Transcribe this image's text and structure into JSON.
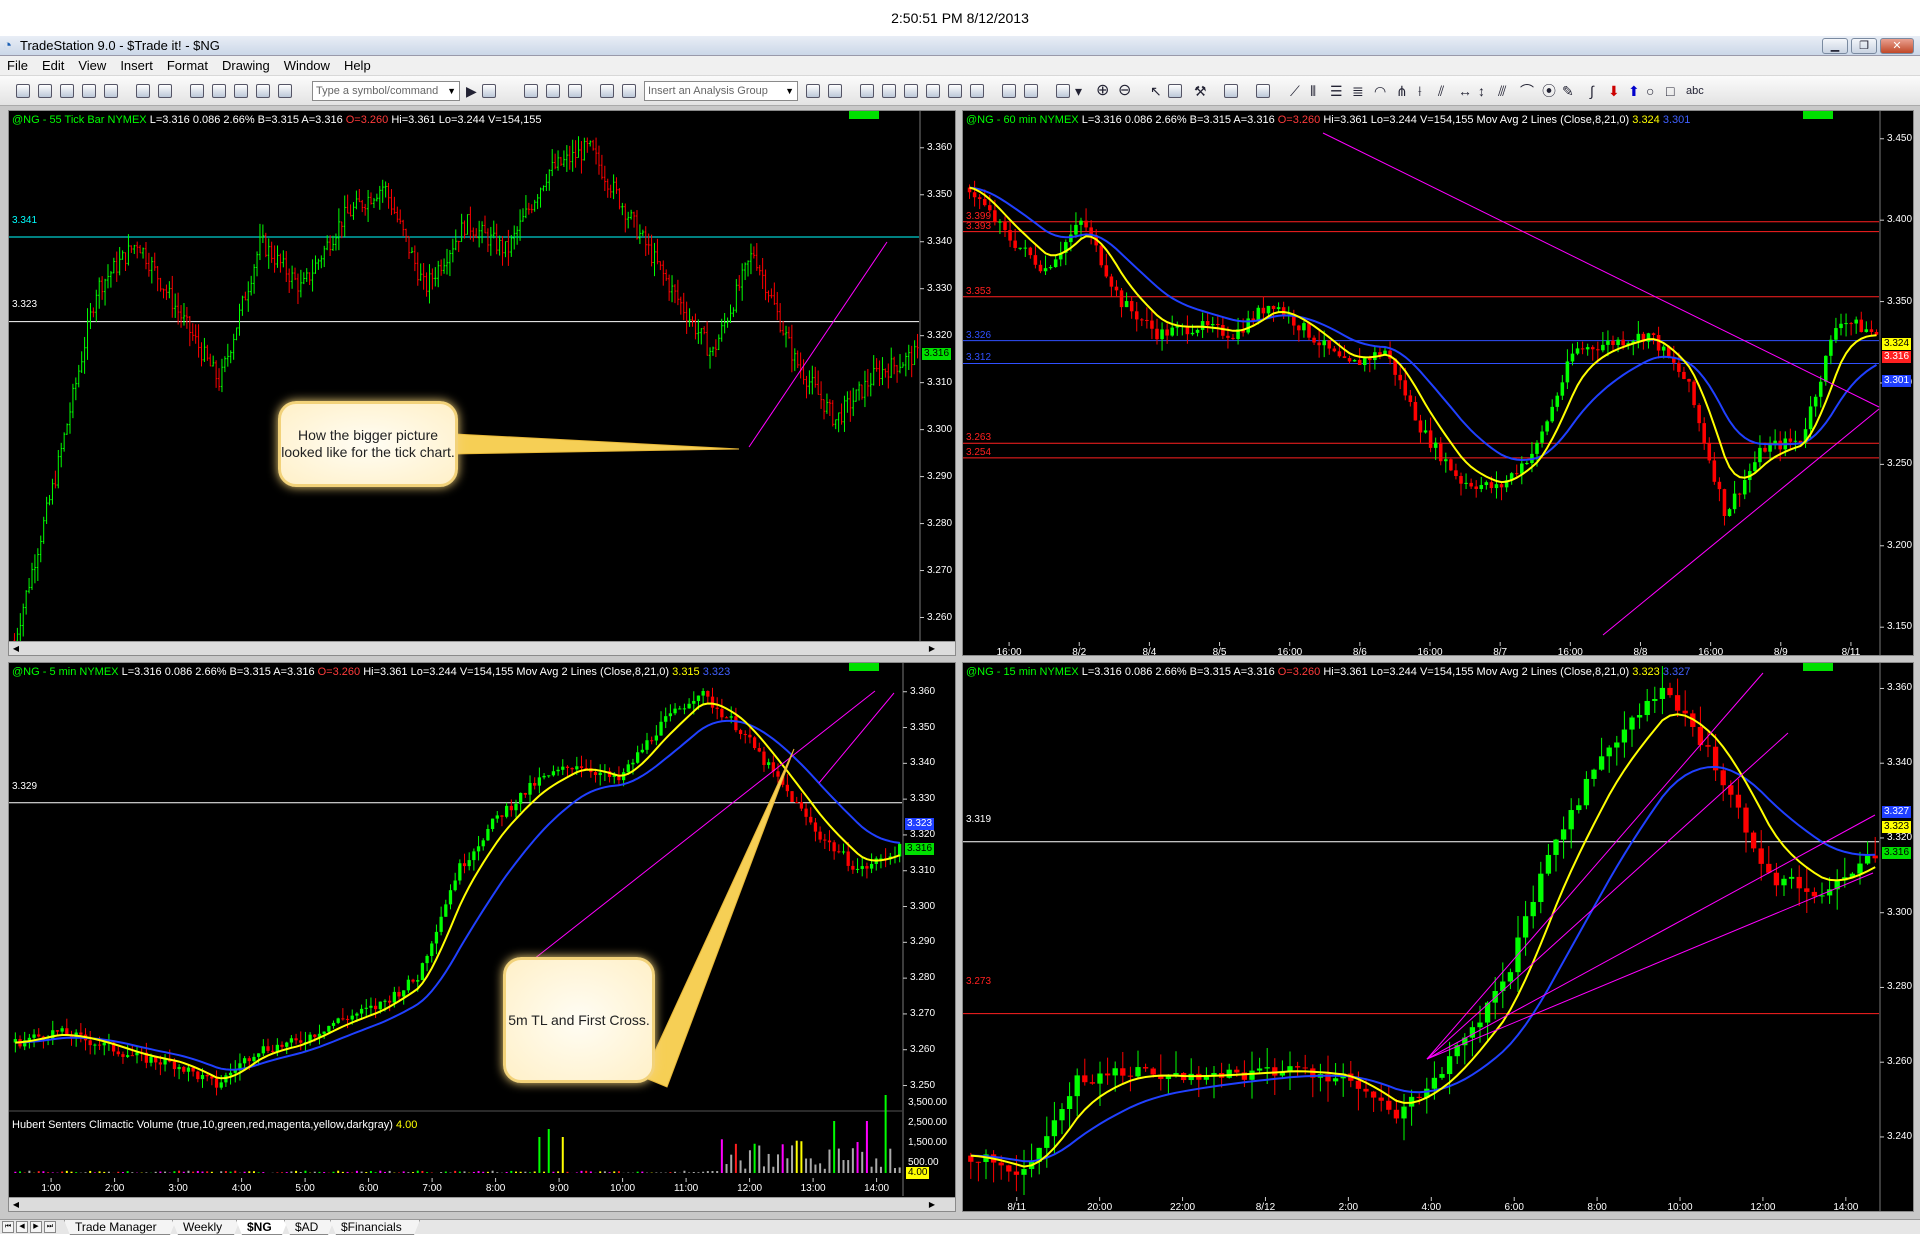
{
  "clock": "2:50:51 PM 8/12/2013",
  "window": {
    "title": "TradeStation 9.0 - $Trade it! - $NG"
  },
  "menu": [
    "File",
    "Edit",
    "View",
    "Insert",
    "Format",
    "Drawing",
    "Window",
    "Help"
  ],
  "toolbar": {
    "symbol_placeholder": "Type a symbol/command",
    "analysis_group": "Insert an Analysis Group"
  },
  "icons": [
    "new-document-icon",
    "open-icon",
    "save-icon",
    "print-icon",
    "zoom-in-icon",
    "zoom-out-icon",
    "pointer-icon",
    "trendline-icon",
    "text-tool-icon"
  ],
  "colors": {
    "background": "#000000",
    "up": "#00ff00",
    "down": "#ff0000",
    "ma_fast": "#ffff00",
    "ma_slow": "#2040ff",
    "trendline": "#ff00ff",
    "hline": "#ffffff",
    "level_red": "#ff2020",
    "level_blue": "#3050ff",
    "level_cyan": "#00ffff"
  },
  "panes": {
    "tick": {
      "header": {
        "symbol": "@NG - 55 Tick Bar  NYMEX",
        "quote": "L=3.316  0.086  2.66%  B=3.315  A=3.316",
        "open": "O=3.260",
        "rest": "Hi=3.361  Lo=3.244  V=154,155"
      },
      "levels": [
        {
          "label": "3.341",
          "value": 3.341,
          "color": "cyan"
        },
        {
          "label": "3.323",
          "value": 3.323,
          "color": "white"
        }
      ],
      "last_price": "3.316",
      "callout": "How the bigger picture looked like for the tick chart."
    },
    "min60": {
      "header": {
        "symbol": "@NG - 60 min  NYMEX",
        "quote": "L=3.316  0.086  2.66%  B=3.315  A=3.316",
        "open": "O=3.260",
        "rest": "Hi=3.361  Lo=3.244  V=154,155  Mov Avg 2 Lines (Close,8,21,0)",
        "ma1": "3.324",
        "ma2": "3.301"
      },
      "levels": [
        {
          "label": "3.399",
          "value": 3.399,
          "color": "red"
        },
        {
          "label": "3.393",
          "value": 3.393,
          "color": "red"
        },
        {
          "label": "3.353",
          "value": 3.353,
          "color": "red"
        },
        {
          "label": "3.326",
          "value": 3.326,
          "color": "blue"
        },
        {
          "label": "3.312",
          "value": 3.312,
          "color": "blue"
        },
        {
          "label": "3.263",
          "value": 3.263,
          "color": "red"
        },
        {
          "label": "3.254",
          "value": 3.254,
          "color": "red"
        }
      ],
      "price_tags": [
        "3.324",
        "3.316",
        "3.301"
      ]
    },
    "min5": {
      "header": {
        "symbol": "@NG - 5 min  NYMEX",
        "quote": "L=3.316  0.086  2.66%  B=3.315  A=3.316",
        "open": "O=3.260",
        "rest": "Hi=3.361  Lo=3.244  V=154,155  Mov Avg 2 Lines (Close,8,21,0)",
        "ma1": "3.315",
        "ma2": "3.323"
      },
      "levels": [
        {
          "label": "3.329",
          "value": 3.329,
          "color": "white"
        }
      ],
      "price_tags": [
        "3.323",
        "3.316"
      ],
      "callout": "5m TL and First Cross.",
      "volume": {
        "title": "Hubert Senters Climactic Volume (true,10,green,red,magenta,yellow,darkgray)",
        "value": "4.00",
        "ticks": [
          "3,500.00",
          "2,500.00",
          "1,500.00",
          "500.00"
        ],
        "tag": "4.00"
      }
    },
    "min15": {
      "header": {
        "symbol": "@NG - 15 min  NYMEX",
        "quote": "L=3.316  0.086  2.66%  B=3.315  A=3.316",
        "open": "O=3.260",
        "rest": "Hi=3.361  Lo=3.244  V=154,155  Mov Avg 2 Lines (Close,8,21,0)",
        "ma1": "3.323",
        "ma2": "3.327"
      },
      "levels": [
        {
          "label": "3.319",
          "value": 3.319,
          "color": "white"
        },
        {
          "label": "3.273",
          "value": 3.273,
          "color": "red"
        }
      ],
      "price_tags": [
        "3.327",
        "3.323",
        "3.316"
      ]
    }
  },
  "chart_data": [
    {
      "type": "candlestick",
      "name": "@NG - 55 Tick Bar",
      "y_ticks": [
        "3.360",
        "3.350",
        "3.340",
        "3.330",
        "3.320",
        "3.310",
        "3.300",
        "3.290",
        "3.280",
        "3.270",
        "3.260"
      ],
      "ylim": [
        3.255,
        3.364
      ],
      "x_ticks": [],
      "key_points": [
        3.255,
        3.29,
        3.33,
        3.34,
        3.325,
        3.31,
        3.34,
        3.33,
        3.345,
        3.352,
        3.33,
        3.344,
        3.338,
        3.355,
        3.36,
        3.345,
        3.33,
        3.316,
        3.338,
        3.315,
        3.302,
        3.312,
        3.316
      ]
    },
    {
      "type": "candlestick",
      "name": "@NG - 60 min",
      "y_ticks": [
        "3.450",
        "3.400",
        "3.350",
        "3.300",
        "3.250",
        "3.200",
        "3.150"
      ],
      "ylim": [
        3.128,
        3.456
      ],
      "x_ticks": [
        "16:00",
        "8/2",
        "8/4",
        "8/5",
        "16:00",
        "8/6",
        "16:00",
        "8/7",
        "16:00",
        "8/8",
        "16:00",
        "8/9",
        "8/11"
      ],
      "key_points": [
        3.42,
        3.39,
        3.37,
        3.4,
        3.35,
        3.33,
        3.335,
        3.33,
        3.35,
        3.33,
        3.31,
        3.32,
        3.27,
        3.24,
        3.235,
        3.26,
        3.32,
        3.325,
        3.33,
        3.3,
        3.22,
        3.26,
        3.265,
        3.34,
        3.33
      ]
    },
    {
      "type": "candlestick",
      "name": "@NG - 5 min",
      "y_ticks": [
        "3.360",
        "3.350",
        "3.340",
        "3.330",
        "3.320",
        "3.310",
        "3.300",
        "3.290",
        "3.280",
        "3.270",
        "3.260",
        "3.250"
      ],
      "ylim": [
        3.244,
        3.363
      ],
      "x_ticks": [
        "1:00",
        "2:00",
        "3:00",
        "4:00",
        "5:00",
        "6:00",
        "7:00",
        "8:00",
        "9:00",
        "10:00",
        "11:00",
        "12:00",
        "13:00",
        "14:00"
      ],
      "key_points": [
        3.262,
        3.265,
        3.262,
        3.258,
        3.256,
        3.25,
        3.26,
        3.262,
        3.268,
        3.272,
        3.28,
        3.31,
        3.325,
        3.335,
        3.34,
        3.335,
        3.35,
        3.36,
        3.35,
        3.335,
        3.32,
        3.31,
        3.316
      ]
    },
    {
      "type": "candlestick",
      "name": "@NG - 15 min",
      "y_ticks": [
        "3.360",
        "3.340",
        "3.320",
        "3.300",
        "3.280",
        "3.260",
        "3.240"
      ],
      "ylim": [
        3.225,
        3.362
      ],
      "x_ticks": [
        "8/11",
        "20:00",
        "22:00",
        "8/12",
        "2:00",
        "4:00",
        "6:00",
        "8:00",
        "10:00",
        "12:00",
        "14:00"
      ],
      "key_points": [
        3.235,
        3.23,
        3.255,
        3.258,
        3.256,
        3.257,
        3.258,
        3.256,
        3.245,
        3.26,
        3.28,
        3.32,
        3.345,
        3.36,
        3.34,
        3.31,
        3.305,
        3.316
      ]
    }
  ],
  "tabs": [
    {
      "label": "Trade Manager",
      "active": false
    },
    {
      "label": "Weekly",
      "active": false
    },
    {
      "label": "$NG",
      "active": true
    },
    {
      "label": "$AD",
      "active": false
    },
    {
      "label": "$Financials",
      "active": false
    }
  ]
}
